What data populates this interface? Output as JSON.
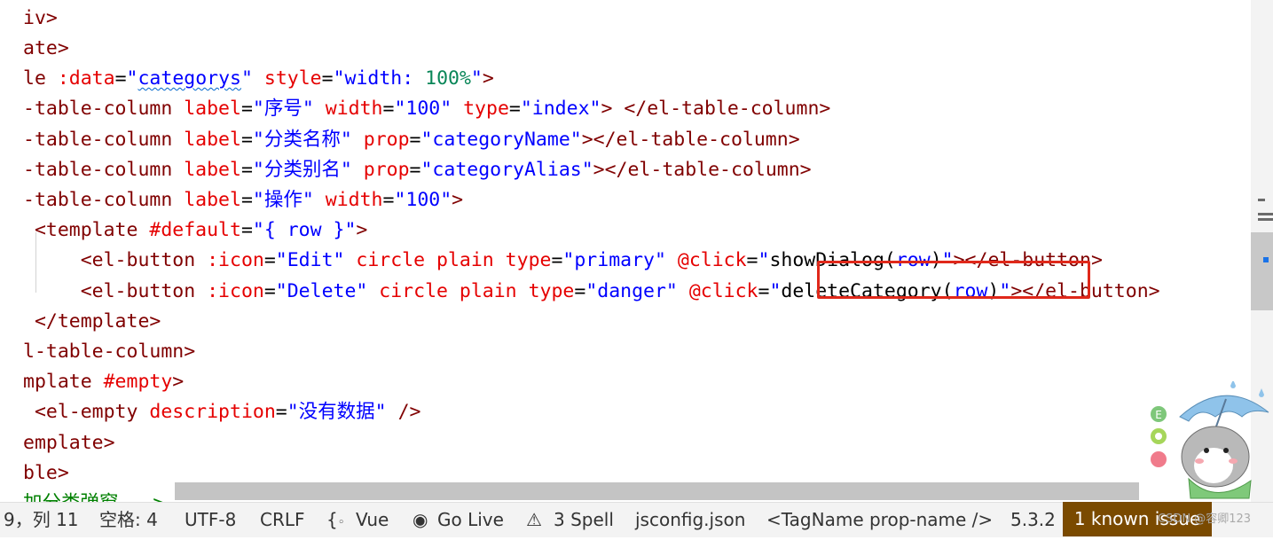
{
  "editor": {
    "lines": [
      [
        [
          "iv>",
          "t-tag"
        ]
      ],
      [
        [
          "ate>",
          "t-tag"
        ]
      ],
      [
        [
          "le ",
          "t-tag"
        ],
        [
          ":data",
          "t-attr"
        ],
        [
          "=",
          "t-plain"
        ],
        [
          "\"",
          "t-str"
        ],
        [
          "categorys",
          "t-str"
        ],
        [
          "\" ",
          "t-str"
        ],
        [
          "style",
          "t-attr"
        ],
        [
          "=",
          "t-plain"
        ],
        [
          "\"width: ",
          "t-str"
        ],
        [
          "100%",
          "t-num"
        ],
        [
          "\"",
          "t-str"
        ],
        [
          ">",
          "t-tag"
        ]
      ],
      [
        [
          "-table-column ",
          "t-tag"
        ],
        [
          "label",
          "t-attr"
        ],
        [
          "=",
          "t-plain"
        ],
        [
          "\"序号\" ",
          "t-str"
        ],
        [
          "width",
          "t-attr"
        ],
        [
          "=",
          "t-plain"
        ],
        [
          "\"100\" ",
          "t-str"
        ],
        [
          "type",
          "t-attr"
        ],
        [
          "=",
          "t-plain"
        ],
        [
          "\"index\"",
          "t-str"
        ],
        [
          "> </el-table-column>",
          "t-tag"
        ]
      ],
      [
        [
          "-table-column ",
          "t-tag"
        ],
        [
          "label",
          "t-attr"
        ],
        [
          "=",
          "t-plain"
        ],
        [
          "\"分类名称\" ",
          "t-str"
        ],
        [
          "prop",
          "t-attr"
        ],
        [
          "=",
          "t-plain"
        ],
        [
          "\"categoryName\"",
          "t-str"
        ],
        [
          "></el-table-column>",
          "t-tag"
        ]
      ],
      [
        [
          "-table-column ",
          "t-tag"
        ],
        [
          "label",
          "t-attr"
        ],
        [
          "=",
          "t-plain"
        ],
        [
          "\"分类别名\" ",
          "t-str"
        ],
        [
          "prop",
          "t-attr"
        ],
        [
          "=",
          "t-plain"
        ],
        [
          "\"categoryAlias\"",
          "t-str"
        ],
        [
          "></el-table-column>",
          "t-tag"
        ]
      ],
      [
        [
          "-table-column ",
          "t-tag"
        ],
        [
          "label",
          "t-attr"
        ],
        [
          "=",
          "t-plain"
        ],
        [
          "\"操作\" ",
          "t-str"
        ],
        [
          "width",
          "t-attr"
        ],
        [
          "=",
          "t-plain"
        ],
        [
          "\"100\"",
          "t-str"
        ],
        [
          ">",
          "t-tag"
        ]
      ],
      [
        [
          " <template ",
          "t-tag"
        ],
        [
          "#default",
          "t-attr"
        ],
        [
          "=",
          "t-plain"
        ],
        [
          "\"{ row }\"",
          "t-str"
        ],
        [
          ">",
          "t-tag"
        ]
      ],
      [
        [
          "     <el-button ",
          "t-tag"
        ],
        [
          ":icon",
          "t-attr"
        ],
        [
          "=",
          "t-plain"
        ],
        [
          "\"Edit\" ",
          "t-str"
        ],
        [
          "circle plain type",
          "t-attr"
        ],
        [
          "=",
          "t-plain"
        ],
        [
          "\"primary\" ",
          "t-str"
        ],
        [
          "@click",
          "t-attr"
        ],
        [
          "=",
          "t-plain"
        ],
        [
          "\"",
          "t-str"
        ],
        [
          "showDialog",
          "t-plain"
        ],
        [
          "(",
          "t-plain"
        ],
        [
          "row",
          "t-str"
        ],
        [
          ")",
          "t-plain"
        ],
        [
          "\"",
          "t-str"
        ],
        [
          "></el-button>",
          "t-tag"
        ]
      ],
      [
        [
          "     <el-button ",
          "t-tag"
        ],
        [
          ":icon",
          "t-attr"
        ],
        [
          "=",
          "t-plain"
        ],
        [
          "\"Delete\" ",
          "t-str"
        ],
        [
          "circle plain type",
          "t-attr"
        ],
        [
          "=",
          "t-plain"
        ],
        [
          "\"danger\" ",
          "t-str"
        ],
        [
          "@click",
          "t-attr"
        ],
        [
          "=",
          "t-plain"
        ],
        [
          "\"",
          "t-str"
        ],
        [
          "deleteCategory",
          "t-plain"
        ],
        [
          "(",
          "t-plain"
        ],
        [
          "row",
          "t-str"
        ],
        [
          ")",
          "t-plain"
        ],
        [
          "\"",
          "t-str"
        ],
        [
          "></el-button>",
          "t-tag"
        ]
      ],
      [
        [
          " </template>",
          "t-tag"
        ]
      ],
      [
        [
          "l-table-column>",
          "t-tag"
        ]
      ],
      [
        [
          "mplate ",
          "t-tag"
        ],
        [
          "#empty",
          "t-attr"
        ],
        [
          ">",
          "t-tag"
        ]
      ],
      [
        [
          " <el-empty ",
          "t-tag"
        ],
        [
          "description",
          "t-attr"
        ],
        [
          "=",
          "t-plain"
        ],
        [
          "\"没有数据\" ",
          "t-str"
        ],
        [
          "/>",
          "t-tag"
        ]
      ],
      [
        [
          "emplate>",
          "t-tag"
        ]
      ],
      [
        [
          "ble>",
          "t-tag"
        ]
      ],
      [
        [
          "加分类弹窗 -->",
          "t-cmt"
        ]
      ]
    ]
  },
  "statusbar": {
    "position": "9，列 11",
    "spaces": "空格: 4",
    "encoding": "UTF-8",
    "eol": "CRLF",
    "language": "Vue",
    "golive": "Go Live",
    "spell": "3 Spell",
    "config": "jsconfig.json",
    "tagname": "<TagName prop-name />",
    "version": "5.3.2",
    "known_issue": "1 known issue",
    "watermark": "CSDN @容卿123"
  }
}
